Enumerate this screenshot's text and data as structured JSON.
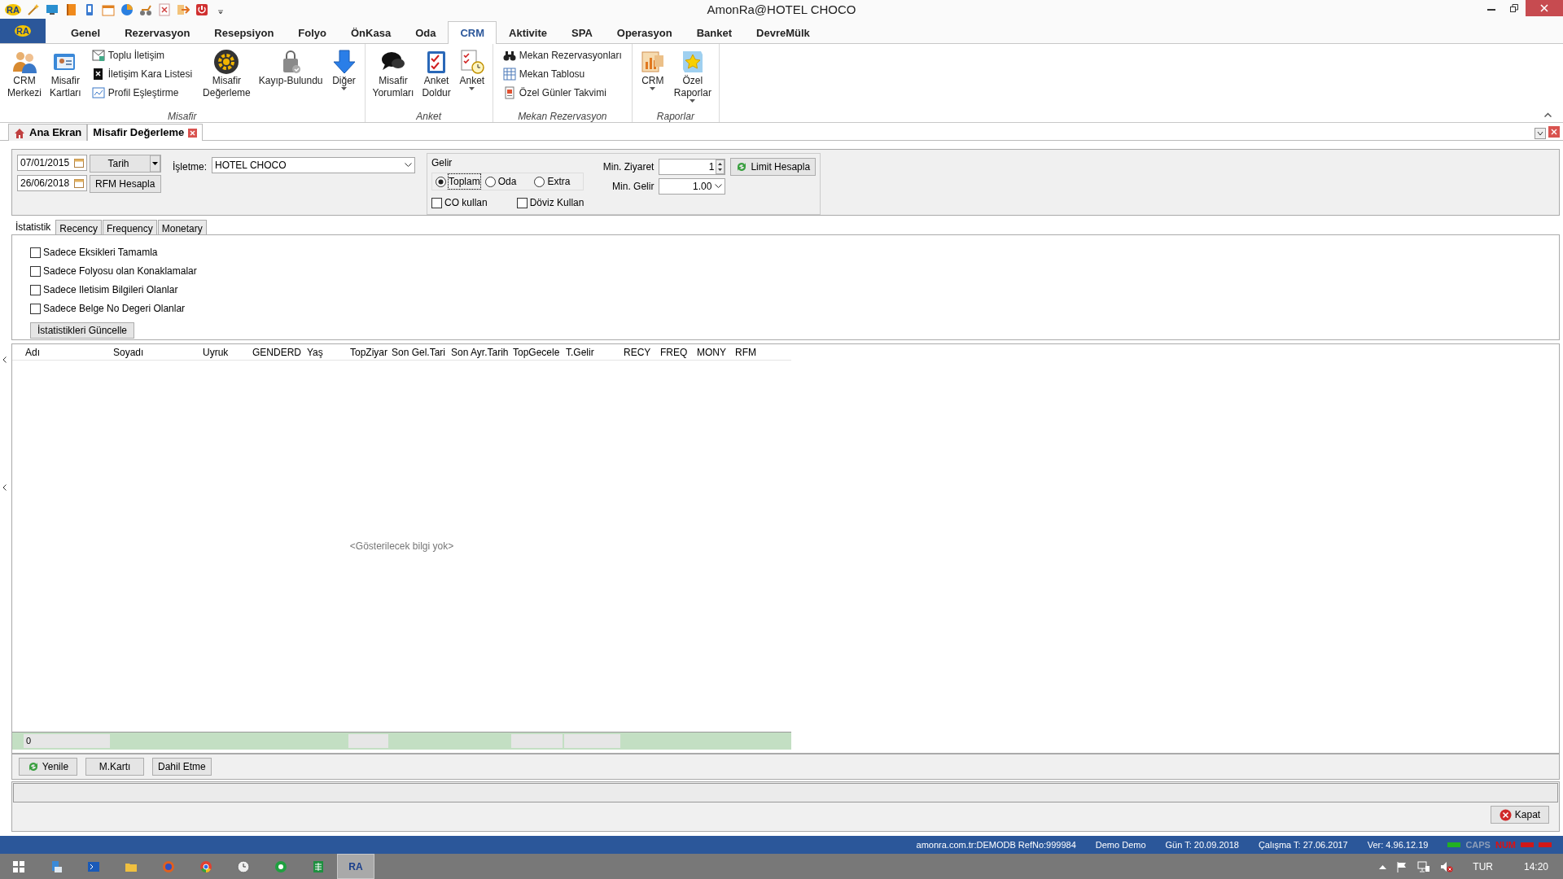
{
  "window": {
    "title": "AmonRa@HOTEL CHOCO",
    "logo": "RA"
  },
  "app_button": {
    "label": "RA"
  },
  "menu_tabs": [
    {
      "label": "Genel",
      "selected": false
    },
    {
      "label": "Rezervasyon",
      "selected": false
    },
    {
      "label": "Resepsiyon",
      "selected": false
    },
    {
      "label": "Folyo",
      "selected": false
    },
    {
      "label": "ÖnKasa",
      "selected": false
    },
    {
      "label": "Oda",
      "selected": false
    },
    {
      "label": "CRM",
      "selected": true
    },
    {
      "label": "Aktivite",
      "selected": false
    },
    {
      "label": "SPA",
      "selected": false
    },
    {
      "label": "Operasyon",
      "selected": false
    },
    {
      "label": "Banket",
      "selected": false
    },
    {
      "label": "DevreMülk",
      "selected": false
    }
  ],
  "ribbon": {
    "groups": [
      {
        "title": "Misafir",
        "items": [
          {
            "kind": "large",
            "label": "CRM\nMerkezi",
            "dropdown": false
          },
          {
            "kind": "large",
            "label": "Misafir\nKartları",
            "dropdown": false
          },
          {
            "kind": "column",
            "items": [
              {
                "label": "Toplu İletişim"
              },
              {
                "label": "İletişim Kara Listesi"
              },
              {
                "label": "Profil Eşleştirme"
              }
            ]
          },
          {
            "kind": "large",
            "label": "Misafir\nDeğerleme",
            "dropdown": false
          },
          {
            "kind": "large",
            "label": "Kayıp-Bulundu",
            "dropdown": false
          },
          {
            "kind": "large",
            "label": "Diğer",
            "dropdown": true
          }
        ]
      },
      {
        "title": "Anket",
        "items": [
          {
            "kind": "large",
            "label": "Misafir\nYorumları",
            "dropdown": false
          },
          {
            "kind": "large",
            "label": "Anket\nDoldur",
            "dropdown": false
          },
          {
            "kind": "large",
            "label": "Anket",
            "dropdown": true
          }
        ]
      },
      {
        "title": "Mekan Rezervasyon",
        "items": [
          {
            "kind": "column",
            "items": [
              {
                "label": "Mekan Rezervasyonları"
              },
              {
                "label": "Mekan Tablosu"
              },
              {
                "label": "Özel Günler Takvimi"
              }
            ]
          }
        ]
      },
      {
        "title": "Raporlar",
        "items": [
          {
            "kind": "large",
            "label": "CRM",
            "dropdown": true
          },
          {
            "kind": "large",
            "label": "Özel\nRaporlar",
            "dropdown": true
          }
        ]
      }
    ]
  },
  "doc_tabs": [
    {
      "label": "Ana Ekran",
      "selected": false,
      "closable": false
    },
    {
      "label": "Misafir Değerleme",
      "selected": true,
      "closable": true
    }
  ],
  "filters": {
    "date_from": "07/01/2015",
    "date_to": "26/06/2018",
    "date_mode": "Tarih",
    "rfm_button": "RFM Hesapla",
    "business_label": "İşletme:",
    "business_value": "HOTEL CHOCO",
    "income": {
      "title": "Gelir",
      "options": [
        {
          "label": "Toplam",
          "selected": true
        },
        {
          "label": "Oda",
          "selected": false
        },
        {
          "label": "Extra",
          "selected": false
        }
      ],
      "checks": [
        {
          "label": "CO kullan",
          "checked": false
        },
        {
          "label": "Döviz Kullan",
          "checked": false
        }
      ]
    },
    "min_visit_label": "Min. Ziyaret",
    "min_visit": "1",
    "min_income_label": "Min. Gelir",
    "min_income": "1.00",
    "limit_button": "Limit Hesapla"
  },
  "stat_tabs": [
    {
      "label": "İstatistik",
      "selected": true
    },
    {
      "label": "Recency",
      "selected": false
    },
    {
      "label": "Frequency",
      "selected": false
    },
    {
      "label": "Monetary",
      "selected": false
    }
  ],
  "options": [
    {
      "label": "Sadece Eksikleri Tamamla",
      "checked": false
    },
    {
      "label": "Sadece Folyosu olan Konaklamalar",
      "checked": false
    },
    {
      "label": "Sadece Iletisim Bilgileri Olanlar",
      "checked": false
    },
    {
      "label": "Sadece Belge No Degeri Olanlar",
      "checked": false
    }
  ],
  "update_button": "İstatistikleri Güncelle",
  "grid": {
    "columns": [
      {
        "label": "Adı",
        "summary": true,
        "summary_text": "0"
      },
      {
        "label": "Soyadı",
        "summary": false
      },
      {
        "label": "Uyruk",
        "summary": false
      },
      {
        "label": "GENDERD",
        "summary": false
      },
      {
        "label": "Yaş",
        "summary": false
      },
      {
        "label": "TopZiyar",
        "summary": true
      },
      {
        "label": "Son Gel.Tari",
        "summary": false
      },
      {
        "label": "Son Ayr.Tarih",
        "summary": false
      },
      {
        "label": "TopGecele",
        "summary": true
      },
      {
        "label": "T.Gelir",
        "summary": true
      },
      {
        "label": "RECY",
        "summary": false
      },
      {
        "label": "FREQ",
        "summary": false
      },
      {
        "label": "MONY",
        "summary": false
      },
      {
        "label": "RFM",
        "summary": false
      }
    ],
    "empty_text": "<Gösterilecek bilgi yok>"
  },
  "buttons": [
    {
      "kind": "refresh",
      "label": "Yenile"
    },
    {
      "kind": "plain",
      "label": "M.Kartı"
    },
    {
      "kind": "plain",
      "label": "Dahil Etme"
    }
  ],
  "close_button": "Kapat",
  "status_bar": {
    "texts": [
      "amonra.com.tr:DEMODB RefNo:999984",
      "Demo Demo",
      "Gün T: 20.09.2018",
      "Çalışma T: 27.06.2017",
      "Ver: 4.96.12.19"
    ],
    "lights_left": [
      {
        "color": "#22b022"
      }
    ],
    "indicators": [
      {
        "label": "CAPS",
        "on": false
      },
      {
        "label": "NUM",
        "on": true
      }
    ],
    "lights_right": [
      {
        "color": "#d01818"
      },
      {
        "color": "#d01818"
      }
    ]
  },
  "taskbar": {
    "running_app": {
      "label": "RA",
      "active": true
    },
    "language": "TUR",
    "time": "14:20"
  }
}
